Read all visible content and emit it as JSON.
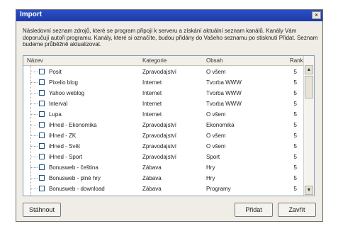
{
  "window": {
    "title": "Import",
    "close_glyph": "×"
  },
  "description": "Následovní seznam zdrojů, které se program připojí k serveru a získání aktuální seznam kanálů. Kanály Vám doporučují autoři programu. Kanály, které si označíte, budou přidány do Vašeho seznamu po stisknutí Přidat. Seznam budeme průběžně aktualizovat.",
  "table": {
    "columns": [
      "Název",
      "Kategorie",
      "Obsah",
      "Rank"
    ],
    "rows": [
      {
        "name": "Posit",
        "category": "Zpravodajství",
        "content": "O všem",
        "rank": "5"
      },
      {
        "name": "Pixelio blog",
        "category": "Internet",
        "content": "Tvorba WWW",
        "rank": "5"
      },
      {
        "name": "Yahoo weblog",
        "category": "Internet",
        "content": "Tvorba WWW",
        "rank": "5"
      },
      {
        "name": "Interval",
        "category": "Internet",
        "content": "Tvorba WWW",
        "rank": "5"
      },
      {
        "name": "Lupa",
        "category": "Internet",
        "content": "O všem",
        "rank": "5"
      },
      {
        "name": "iHned - Ekonomika",
        "category": "Zpravodajství",
        "content": "Ekonomika",
        "rank": "5"
      },
      {
        "name": "iHned - ZK",
        "category": "Zpravodajství",
        "content": "O všem",
        "rank": "5"
      },
      {
        "name": "iHned - Svět",
        "category": "Zpravodajství",
        "content": "O všem",
        "rank": "5"
      },
      {
        "name": "iHned - Sport",
        "category": "Zpravodajství",
        "content": "Sport",
        "rank": "5"
      },
      {
        "name": "Bonusweb - čeština",
        "category": "Zábava",
        "content": "Hry",
        "rank": "5"
      },
      {
        "name": "Bonusweb - plné hry",
        "category": "Zábava",
        "content": "Hry",
        "rank": "5"
      },
      {
        "name": "Bonusweb - download",
        "category": "Zábava",
        "content": "Programy",
        "rank": "5"
      }
    ]
  },
  "buttons": {
    "refresh": "Stáhnout",
    "add": "Přidat",
    "close": "Zavřít"
  },
  "icons": {
    "scroll_up": "▲",
    "scroll_down": "▼"
  }
}
